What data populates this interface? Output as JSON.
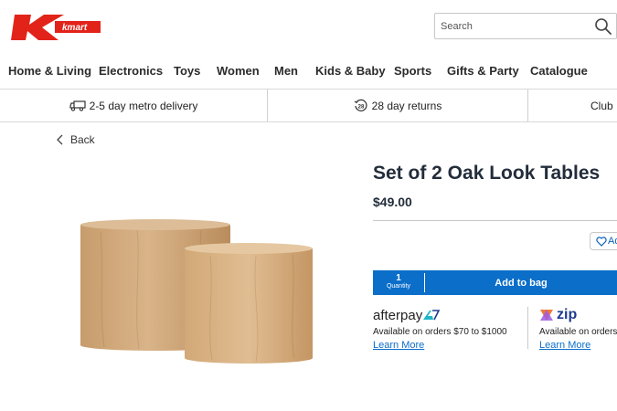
{
  "header": {
    "logo_text": "kmart",
    "search": {
      "placeholder": "Search"
    }
  },
  "nav": {
    "items": [
      {
        "label": "Home & Living"
      },
      {
        "label": "Electronics"
      },
      {
        "label": "Toys"
      },
      {
        "label": "Women"
      },
      {
        "label": "Men"
      },
      {
        "label": "Kids & Baby"
      },
      {
        "label": "Sports"
      },
      {
        "label": "Gifts & Party"
      },
      {
        "label": "Catalogue"
      }
    ]
  },
  "benefits": {
    "delivery": "2-5 day metro delivery",
    "returns_badge": "28",
    "returns": "28 day returns",
    "club": "Club"
  },
  "back_label": "Back",
  "product": {
    "title": "Set of 2 Oak Look Tables",
    "price": "$49.00",
    "wishlist_label": "Ad",
    "quantity_value": "1",
    "quantity_label": "Quantity",
    "add_to_bag": "Add to bag"
  },
  "payments": {
    "afterpay": {
      "brand": "afterpay",
      "text": "Available on orders $70 to $1000",
      "link": "Learn More"
    },
    "zip": {
      "brand": "zip",
      "text": "Available on orders",
      "link": "Learn More"
    }
  },
  "colors": {
    "brand_red": "#e2231a",
    "primary_blue": "#0b6ec9",
    "afterpay_accent": "#1fb5c9",
    "zip_accent": "#1d3a8f"
  }
}
